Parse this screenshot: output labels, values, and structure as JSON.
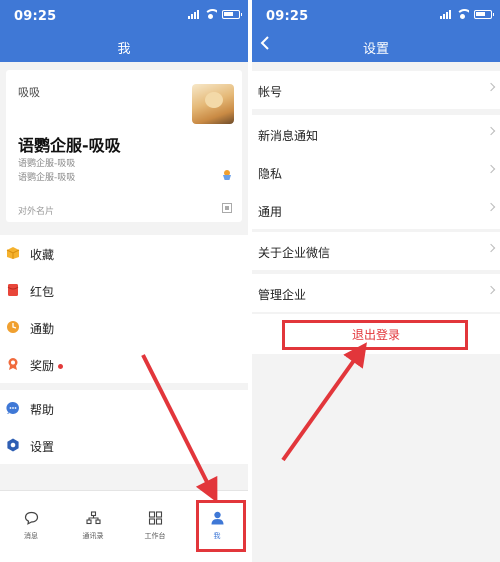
{
  "status": {
    "time_left": "09:25",
    "time_right": "09:25"
  },
  "left": {
    "title": "我",
    "profile": {
      "nickname": "吸吸",
      "name": "语鹦企服-吸吸",
      "line1": "语鹦企服-吸吸",
      "line2": "语鹦企服-吸吸",
      "external_card": "对外名片"
    },
    "menu_group1": [
      {
        "label": "收藏",
        "icon": "favorites-icon"
      },
      {
        "label": "红包",
        "icon": "red-packet-icon"
      },
      {
        "label": "通勤",
        "icon": "commute-icon"
      },
      {
        "label": "奖励",
        "icon": "reward-icon"
      }
    ],
    "menu_group2": [
      {
        "label": "帮助",
        "icon": "help-icon"
      },
      {
        "label": "设置",
        "icon": "settings-icon"
      }
    ],
    "tabs": [
      {
        "label": "消息",
        "icon": "chat-bubble-icon"
      },
      {
        "label": "通讯录",
        "icon": "contacts-icon"
      },
      {
        "label": "工作台",
        "icon": "workbench-grid-icon"
      },
      {
        "label": "我",
        "icon": "person-icon"
      }
    ],
    "active_tab": "我"
  },
  "right": {
    "title": "设置",
    "items": [
      {
        "label": "帐号"
      },
      {
        "label": "新消息通知"
      },
      {
        "label": "隐私"
      },
      {
        "label": "通用"
      },
      {
        "label": "关于企业微信"
      },
      {
        "label": "管理企业"
      }
    ],
    "logout": "退出登录"
  },
  "colors": {
    "header_blue": "#3f78d6",
    "highlight_red": "#e2363b",
    "background": "#f3f3f3"
  }
}
